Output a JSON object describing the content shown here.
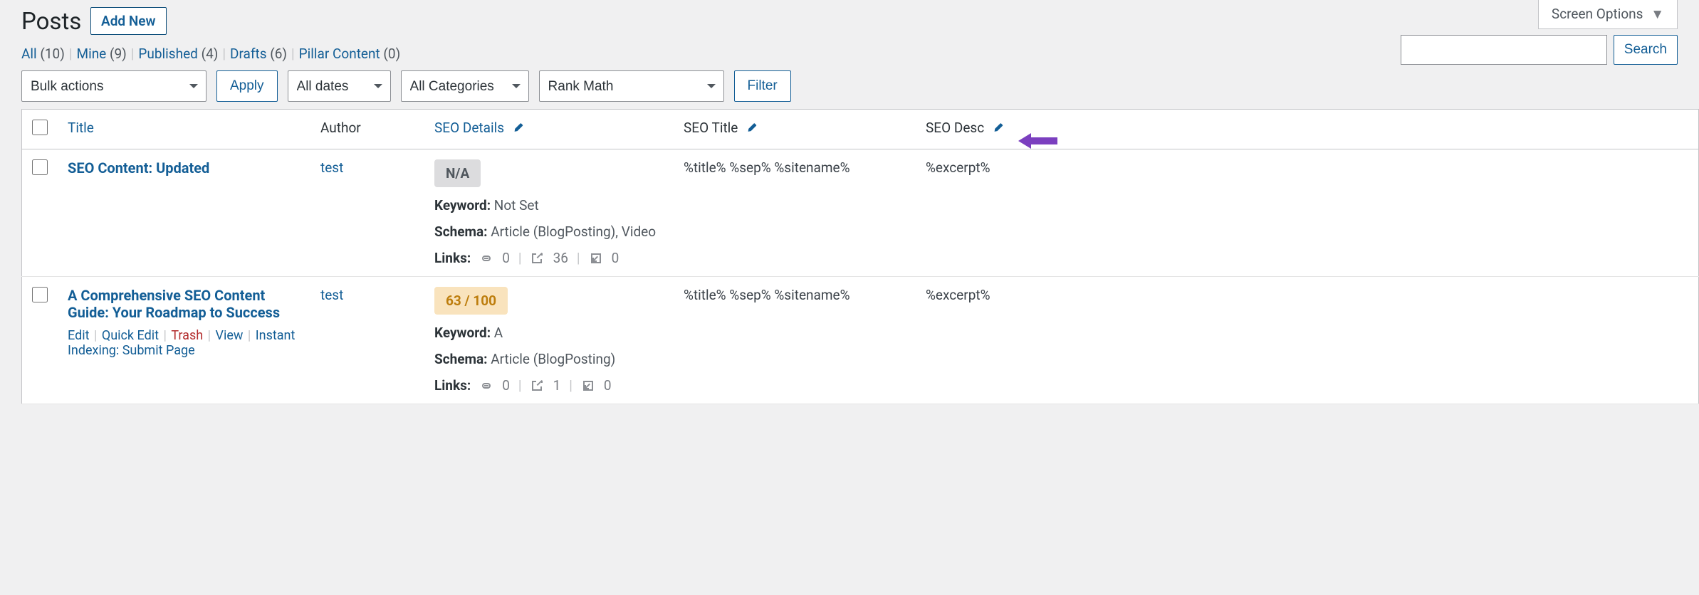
{
  "header": {
    "screen_options": "Screen Options",
    "page_title": "Posts",
    "add_new": "Add New",
    "search_button": "Search"
  },
  "filters": {
    "views": [
      {
        "label": "All",
        "count": "(10)"
      },
      {
        "label": "Mine",
        "count": "(9)"
      },
      {
        "label": "Published",
        "count": "(4)"
      },
      {
        "label": "Drafts",
        "count": "(6)"
      },
      {
        "label": "Pillar Content",
        "count": "(0)"
      }
    ],
    "bulk": "Bulk actions",
    "apply": "Apply",
    "dates": "All dates",
    "categories": "All Categories",
    "rankmath": "Rank Math",
    "filter": "Filter"
  },
  "columns": {
    "title": "Title",
    "author": "Author",
    "seo_details": "SEO Details",
    "seo_title": "SEO Title",
    "seo_desc": "SEO Desc"
  },
  "rows": [
    {
      "title": "SEO Content: Updated",
      "author": "test",
      "score": "N/A",
      "score_class": "na",
      "keyword_label": "Keyword:",
      "keyword": "Not Set",
      "schema_label": "Schema:",
      "schema": "Article (BlogPosting), Video",
      "links_label": "Links:",
      "links_internal": "0",
      "links_external": "36",
      "links_incoming": "0",
      "seo_title": "%title% %sep% %sitename%",
      "seo_desc": "%excerpt%",
      "show_actions": false
    },
    {
      "title": "A Comprehensive SEO Content Guide: Your Roadmap to Success",
      "author": "test",
      "score": "63 / 100",
      "score_class": "mid",
      "keyword_label": "Keyword:",
      "keyword": "A",
      "schema_label": "Schema:",
      "schema": "Article (BlogPosting)",
      "links_label": "Links:",
      "links_internal": "0",
      "links_external": "1",
      "links_incoming": "0",
      "seo_title": "%title% %sep% %sitename%",
      "seo_desc": "%excerpt%",
      "show_actions": true,
      "actions": {
        "edit": "Edit",
        "quick_edit": "Quick Edit",
        "trash": "Trash",
        "view": "View",
        "instant": "Instant Indexing: Submit Page"
      }
    }
  ]
}
